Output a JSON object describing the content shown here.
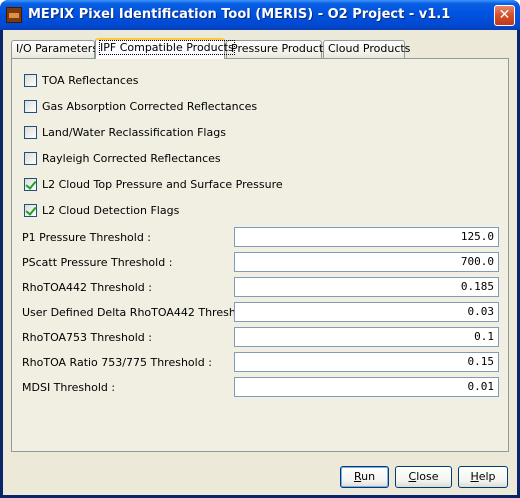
{
  "window": {
    "title": "MEPIX Pixel Identification Tool (MERIS) - O2 Project - v1.1",
    "close_glyph": "✕"
  },
  "tabs": [
    {
      "label": "I/O Parameters",
      "active": false
    },
    {
      "label": "IPF Compatible Products",
      "active": true
    },
    {
      "label": "Pressure Products",
      "active": false
    },
    {
      "label": "Cloud Products",
      "active": false
    }
  ],
  "checkboxes": [
    {
      "label": "TOA Reflectances",
      "checked": false
    },
    {
      "label": "Gas Absorption Corrected Reflectances",
      "checked": false
    },
    {
      "label": "Land/Water Reclassification Flags",
      "checked": false
    },
    {
      "label": "Rayleigh Corrected Reflectances",
      "checked": false
    },
    {
      "label": "L2 Cloud Top Pressure and Surface Pressure",
      "checked": true
    },
    {
      "label": "L2 Cloud Detection Flags",
      "checked": true
    }
  ],
  "fields": [
    {
      "label": "P1 Pressure Threshold :",
      "value": "125.0"
    },
    {
      "label": "PScatt Pressure Threshold :",
      "value": "700.0"
    },
    {
      "label": "RhoTOA442 Threshold :",
      "value": "0.185"
    },
    {
      "label": "User Defined Delta RhoTOA442 Threshold :",
      "value": "0.03"
    },
    {
      "label": "RhoTOA753 Threshold :",
      "value": "0.1"
    },
    {
      "label": "RhoTOA Ratio 753/775 Threshold :",
      "value": "0.15"
    },
    {
      "label": "MDSI Threshold :",
      "value": "0.01"
    }
  ],
  "buttons": {
    "run": {
      "mnemonic": "R",
      "rest": "un"
    },
    "close": {
      "mnemonic": "C",
      "rest": "lose"
    },
    "help": {
      "mnemonic": "H",
      "rest": "elp"
    }
  },
  "colors": {
    "titlebar": "#0054e3",
    "face": "#ece9d8",
    "check": "#21a121"
  }
}
